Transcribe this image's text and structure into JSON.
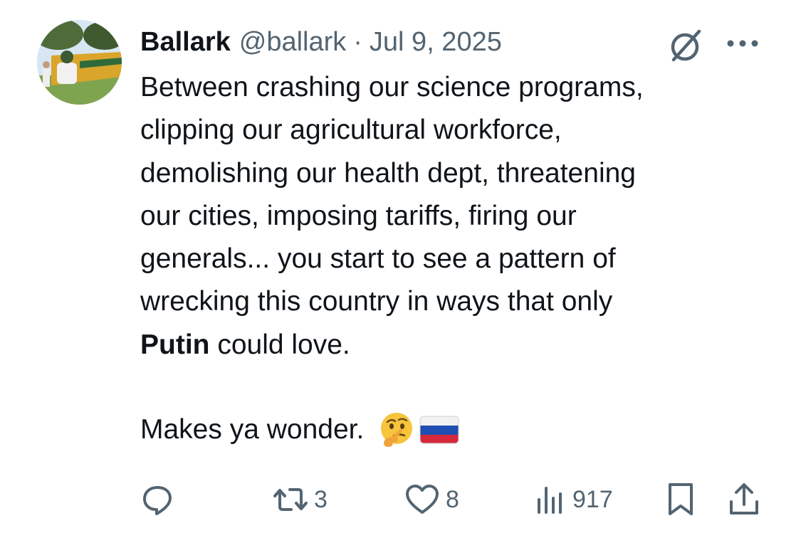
{
  "post": {
    "display_name": "Ballark",
    "handle": "@ballark",
    "separator": "·",
    "date": "Jul 9, 2025",
    "body_lines": [
      "Between crashing our science programs,",
      "clipping our agricultural workforce,",
      "demolishing our health dept, threatening",
      "our cities, imposing tariffs, firing our",
      "generals... you start to see a pattern of",
      "wrecking this country in ways that only"
    ],
    "last_line_bold": "Putin",
    "last_line_rest": " could love.",
    "closing_text": "Makes ya wonder.",
    "emojis": [
      "thinking-face",
      "flag-russia"
    ]
  },
  "actions": {
    "reply": {
      "icon": "reply-icon"
    },
    "repost": {
      "icon": "repost-icon",
      "count": "3"
    },
    "like": {
      "icon": "heart-icon",
      "count": "8"
    },
    "views": {
      "icon": "views-icon",
      "count": "917"
    },
    "bookmark": {
      "icon": "bookmark-icon"
    },
    "share": {
      "icon": "share-icon"
    }
  },
  "colors": {
    "text": "#0f1419",
    "secondary": "#536471",
    "background": "#ffffff"
  }
}
